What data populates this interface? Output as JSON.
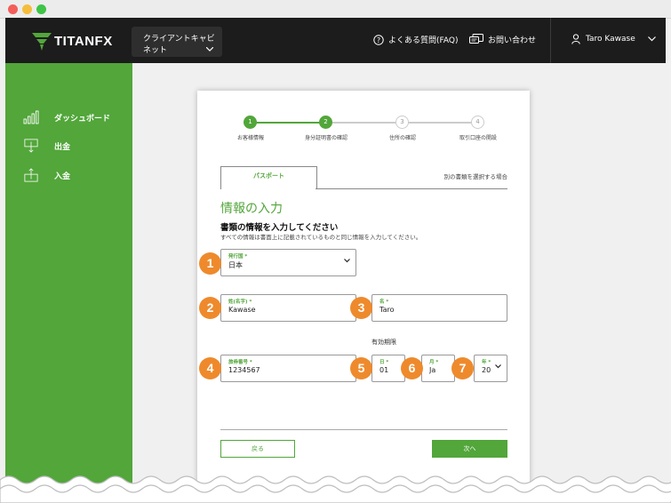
{
  "app": {
    "logo_text": "TITANFX"
  },
  "topnav": {
    "cabinet_label": "クライアントキャビネット",
    "faq_label": "よくある質問(FAQ)",
    "contact_label": "お問い合わせ",
    "user_name": "Taro Kawase"
  },
  "sidebar": {
    "items": [
      {
        "label": "ダッシュボード",
        "icon": "bar-chart-icon"
      },
      {
        "label": "出金",
        "icon": "withdraw-icon"
      },
      {
        "label": "入金",
        "icon": "deposit-icon"
      }
    ]
  },
  "stepper": {
    "steps": [
      {
        "num": "1",
        "label": "お客様情報",
        "state": "done"
      },
      {
        "num": "2",
        "label": "身分証明書の確認",
        "state": "current"
      },
      {
        "num": "3",
        "label": "住所の確認",
        "state": "todo"
      },
      {
        "num": "4",
        "label": "取引口座の開設",
        "state": "todo"
      }
    ]
  },
  "tabs": {
    "active": "パスポート",
    "alternate": "別の書類を選択する場合"
  },
  "form": {
    "title": "情報の入力",
    "subtitle": "書類の情報を入力してください",
    "description": "すべての情報は書面上に記載されているものと同じ情報を入力してください。",
    "issuing_country": {
      "label": "発行国 *",
      "value": "日本"
    },
    "last_name": {
      "label": "姓(名字) *",
      "value": "Kawase"
    },
    "first_name": {
      "label": "名 *",
      "value": "Taro"
    },
    "expiry_heading": "有効期限",
    "passport_number": {
      "label": "旅券番号 *",
      "value": "1234567"
    },
    "day": {
      "label": "日 *",
      "value": "01"
    },
    "month": {
      "label": "月 *",
      "value": "Ja"
    },
    "year": {
      "label": "年 *",
      "value": "20"
    },
    "badges": [
      "1",
      "2",
      "3",
      "4",
      "5",
      "6",
      "7"
    ],
    "back_label": "戻る",
    "next_label": "次へ"
  },
  "colors": {
    "brand_green": "#52a63a",
    "badge_orange": "#ee8a2c",
    "nav_dark": "#1c1c1c"
  }
}
